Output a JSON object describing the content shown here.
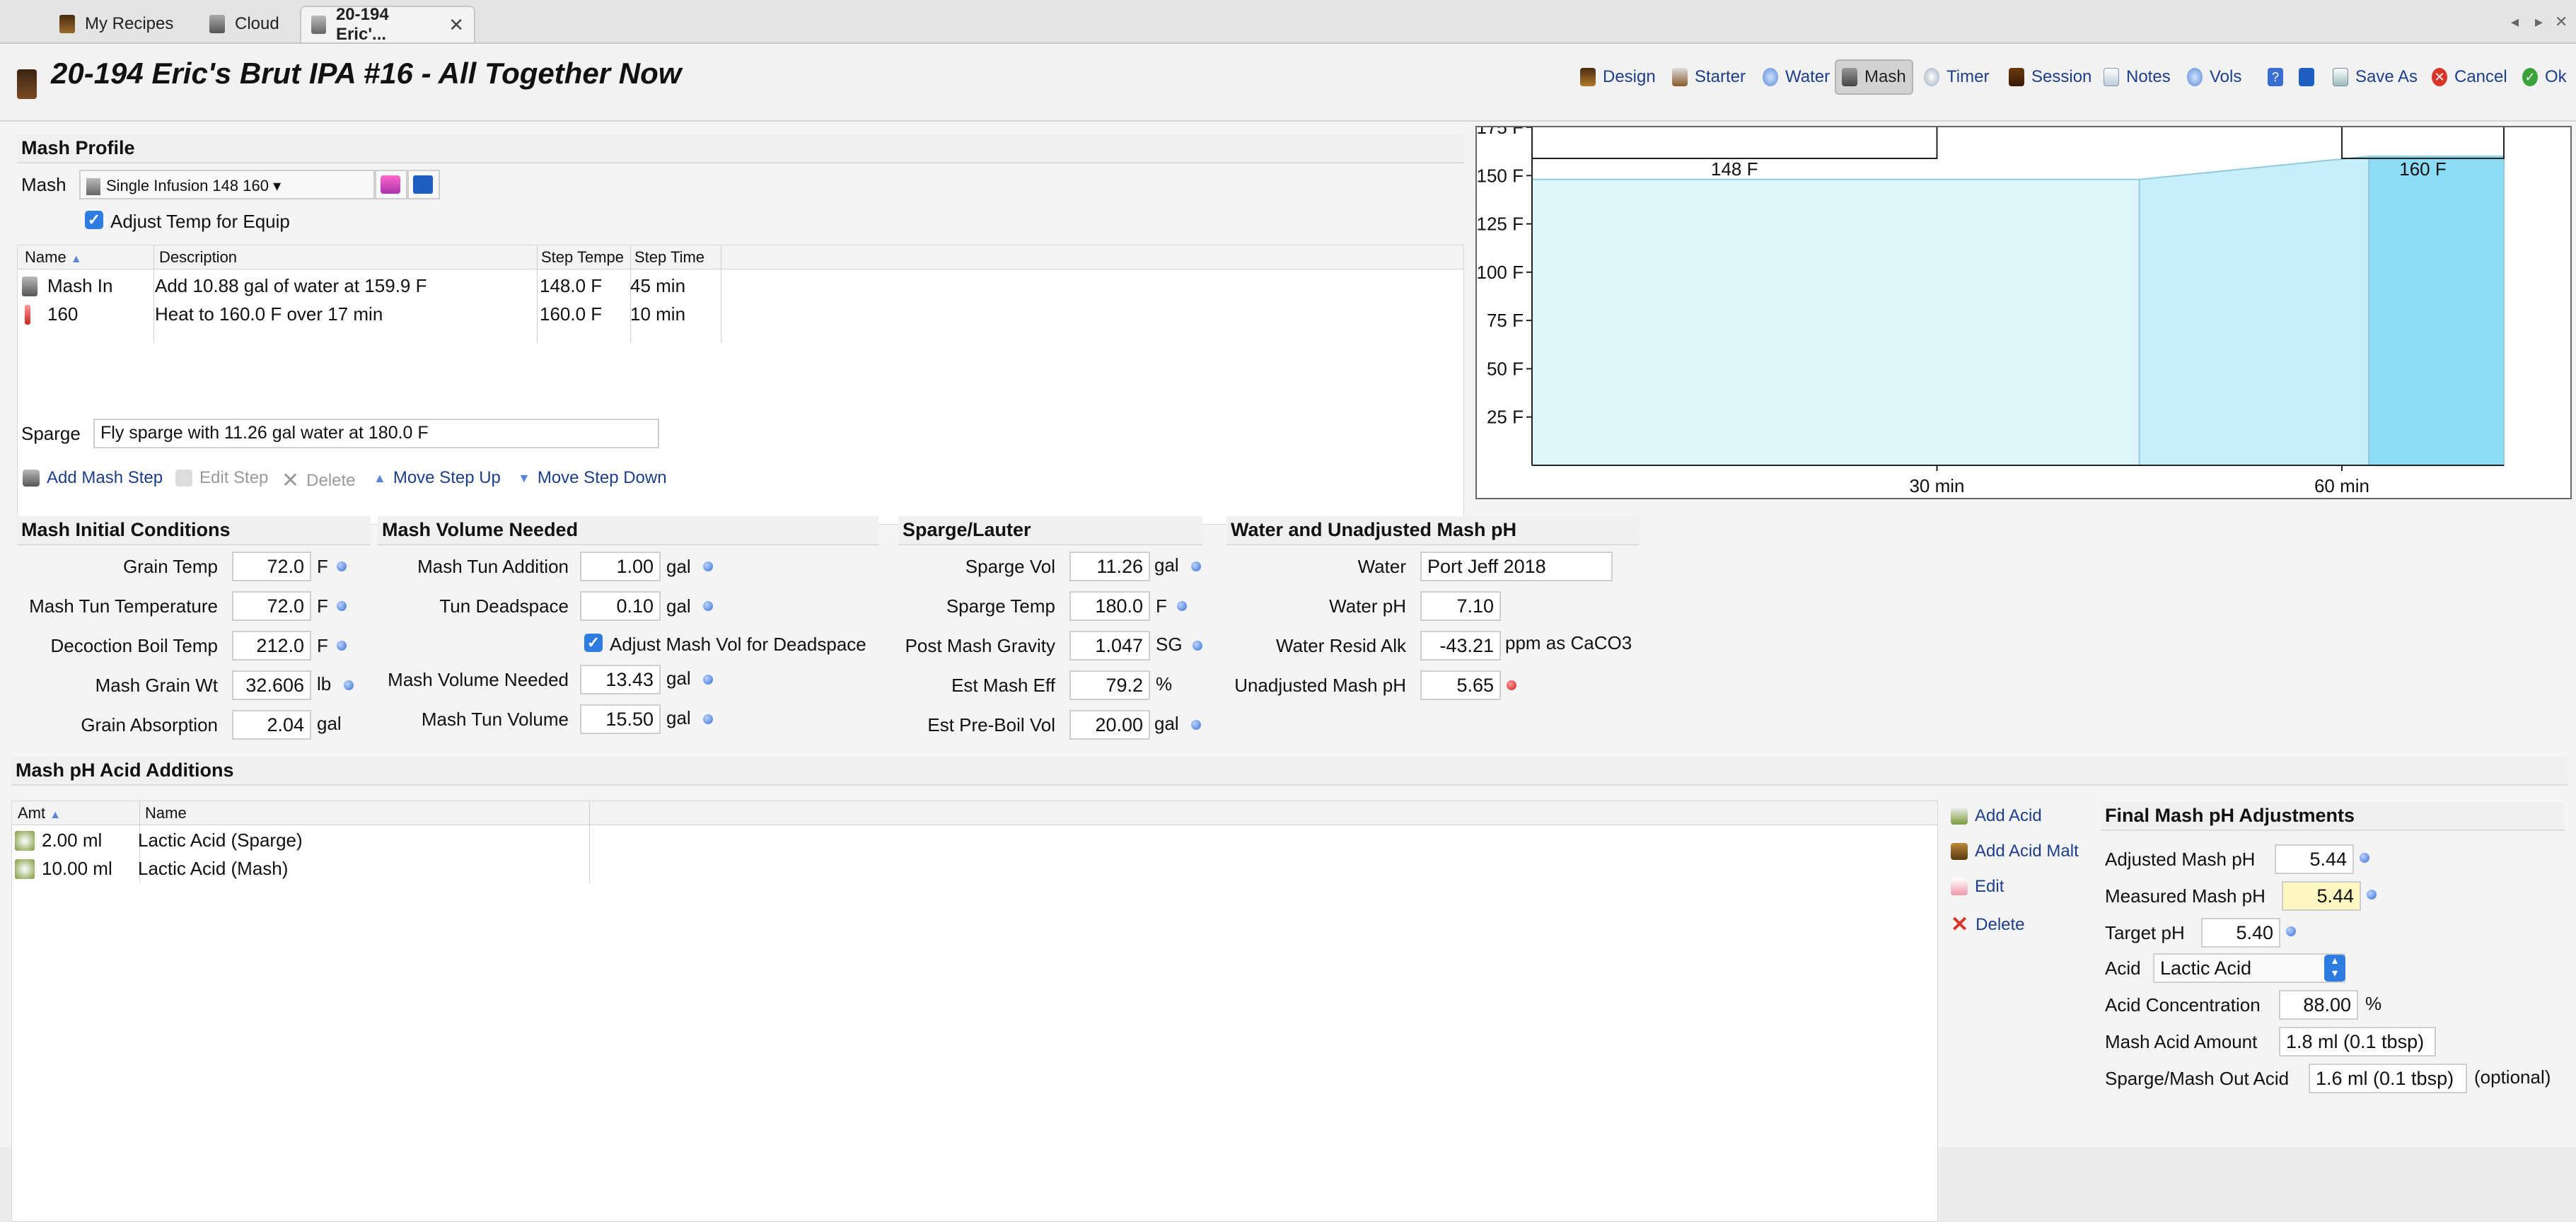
{
  "tabs": [
    {
      "label": "My Recipes",
      "icon": "beer-glass-icon"
    },
    {
      "label": "Cloud",
      "icon": "cloud-icon"
    },
    {
      "label": "20-194 Eric'...",
      "icon": "recipe-icon",
      "active": true
    }
  ],
  "header": {
    "title": "20-194 Eric's Brut IPA #16 - All Together Now",
    "toolbar": [
      {
        "label": "Design",
        "icon": "beer-glass-icon"
      },
      {
        "label": "Starter",
        "icon": "flask-icon"
      },
      {
        "label": "Water",
        "icon": "water-drop-icon"
      },
      {
        "label": "Mash",
        "icon": "mash-tun-icon",
        "active": true
      },
      {
        "label": "Timer",
        "icon": "clock-icon"
      },
      {
        "label": "Session",
        "icon": "barrel-icon"
      },
      {
        "label": "Notes",
        "icon": "notes-icon"
      },
      {
        "label": "Vols",
        "icon": "volume-drop-icon"
      }
    ],
    "actions": [
      {
        "label": "",
        "icon": "help-icon"
      },
      {
        "label": "",
        "icon": "save-icon"
      },
      {
        "label": "Save As",
        "icon": "save-as-icon"
      },
      {
        "label": "Cancel",
        "icon": "cancel-icon"
      },
      {
        "label": "Ok",
        "icon": "ok-icon"
      }
    ]
  },
  "mash_profile": {
    "section_title": "Mash Profile",
    "mash_label": "Mash",
    "mash_value": "Single Infusion 148 160",
    "adjust_temp_label": "Adjust Temp for Equip",
    "adjust_temp_checked": true,
    "columns": [
      "Name",
      "Description",
      "Step Tempe",
      "Step Time"
    ],
    "steps": [
      {
        "name": "Mash In",
        "description": "Add 10.88 gal of water at 159.9 F",
        "temp": "148.0 F",
        "time": "45 min"
      },
      {
        "name": "160",
        "description": "Heat to 160.0 F over 17 min",
        "temp": "160.0 F",
        "time": "10 min"
      }
    ],
    "sparge_label": "Sparge",
    "sparge_value": "Fly sparge with 11.26 gal water at 180.0 F",
    "buttons": {
      "add": "Add Mash Step",
      "edit": "Edit Step",
      "delete": "Delete",
      "move_up": "Move Step Up",
      "move_down": "Move Step Down"
    }
  },
  "initial_conditions": {
    "title": "Mash Initial Conditions",
    "rows": [
      {
        "label": "Grain Temp",
        "value": "72.0",
        "unit": "F"
      },
      {
        "label": "Mash Tun Temperature",
        "value": "72.0",
        "unit": "F"
      },
      {
        "label": "Decoction Boil Temp",
        "value": "212.0",
        "unit": "F"
      },
      {
        "label": "Mash Grain Wt",
        "value": "32.606",
        "unit": "lb"
      },
      {
        "label": "Grain Absorption",
        "value": "2.04",
        "unit": "gal"
      }
    ]
  },
  "volume_needed": {
    "title": "Mash Volume Needed",
    "rows": [
      {
        "label": "Mash Tun Addition",
        "value": "1.00",
        "unit": "gal"
      },
      {
        "label": "Tun Deadspace",
        "value": "0.10",
        "unit": "gal"
      },
      {
        "label": "Mash Volume Needed",
        "value": "13.43",
        "unit": "gal"
      },
      {
        "label": "Mash Tun Volume",
        "value": "15.50",
        "unit": "gal"
      }
    ],
    "adjust_deadspace_label": "Adjust Mash Vol for Deadspace",
    "adjust_deadspace_checked": true
  },
  "sparge_lauter": {
    "title": "Sparge/Lauter",
    "rows": [
      {
        "label": "Sparge Vol",
        "value": "11.26",
        "unit": "gal"
      },
      {
        "label": "Sparge Temp",
        "value": "180.0",
        "unit": "F"
      },
      {
        "label": "Post Mash Gravity",
        "value": "1.047",
        "unit": "SG"
      },
      {
        "label": "Est Mash Eff",
        "value": "79.2",
        "unit": "%"
      },
      {
        "label": "Est Pre-Boil Vol",
        "value": "20.00",
        "unit": "gal"
      }
    ]
  },
  "water_ph": {
    "title": "Water and Unadjusted Mash pH",
    "rows": [
      {
        "label": "Water",
        "value": "Port Jeff 2018",
        "unit": ""
      },
      {
        "label": "Water pH",
        "value": "7.10",
        "unit": ""
      },
      {
        "label": "Water Resid Alk",
        "value": "-43.21",
        "unit": "ppm as CaCO3"
      },
      {
        "label": "Unadjusted Mash pH",
        "value": "5.65",
        "unit": ""
      }
    ]
  },
  "acid_additions": {
    "title": "Mash pH Acid Additions",
    "columns": [
      "Amt",
      "Name"
    ],
    "rows": [
      {
        "amt": "2.00 ml",
        "name": "Lactic Acid (Sparge)"
      },
      {
        "amt": "10.00 ml",
        "name": "Lactic Acid (Mash)"
      }
    ],
    "buttons": {
      "add_acid": "Add Acid",
      "add_acid_malt": "Add Acid Malt",
      "edit": "Edit",
      "delete": "Delete"
    }
  },
  "final_ph": {
    "title": "Final Mash pH Adjustments",
    "adjusted_label": "Adjusted Mash pH",
    "adjusted_value": "5.44",
    "measured_label": "Measured Mash pH",
    "measured_value": "5.44",
    "target_label": "Target pH",
    "target_value": "5.40",
    "acid_label": "Acid",
    "acid_value": "Lactic Acid",
    "concentration_label": "Acid Concentration",
    "concentration_value": "88.00",
    "concentration_unit": "%",
    "mash_acid_label": "Mash Acid Amount",
    "mash_acid_value": "1.8 ml (0.1 tbsp)",
    "sparge_acid_label": "Sparge/Mash Out Acid",
    "sparge_acid_value": "1.6 ml (0.1 tbsp)",
    "sparge_acid_note": "(optional)"
  },
  "chart_data": {
    "type": "area",
    "ylim": [
      0,
      175
    ],
    "y_ticks": [
      25,
      50,
      75,
      100,
      125,
      150,
      175
    ],
    "y_tick_labels": [
      "25 F",
      "50 F",
      "75 F",
      "100 F",
      "125 F",
      "150 F",
      "175 F"
    ],
    "xlim": [
      0,
      72
    ],
    "x_ticks": [
      30,
      60
    ],
    "x_tick_labels": [
      "30 min",
      "60 min"
    ],
    "series": [
      {
        "x": [
          0,
          45,
          62,
          72
        ],
        "y": [
          148,
          148,
          160,
          160
        ]
      }
    ],
    "step_labels": [
      {
        "text": "148 F",
        "x_start": 0,
        "x_end": 30
      },
      {
        "text": "160 F",
        "x_start": 60,
        "x_end": 72
      }
    ],
    "colors": {
      "fill": "#dff5fc",
      "fill_dark": "#8ddcf5",
      "stroke": "#8fcbe0"
    }
  },
  "colors": {
    "accent": "#2f7ce0",
    "link": "#1d3f8a",
    "dot": "#3a6fd1",
    "alert": "#cc1f1f",
    "highlight": "#fff7c2"
  }
}
